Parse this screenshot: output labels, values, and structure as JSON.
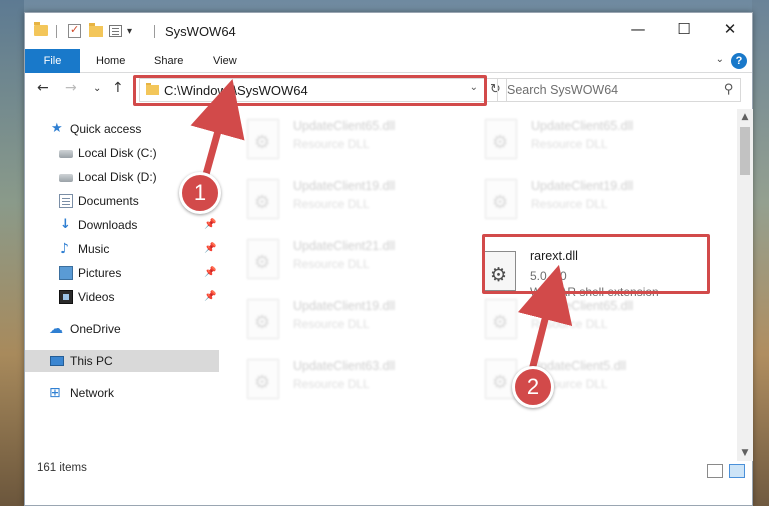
{
  "window": {
    "title": "SysWOW64",
    "controls": {
      "minimize": "—",
      "maximize": "☐",
      "close": "✕"
    },
    "quick_access_dropdown": "▾"
  },
  "ribbon": {
    "tabs": [
      {
        "label": "File"
      },
      {
        "label": "Home"
      },
      {
        "label": "Share"
      },
      {
        "label": "View"
      }
    ],
    "help": "?",
    "collapse": "⌄"
  },
  "nav": {
    "back": "←",
    "forward": "→",
    "recent": "⌄",
    "up": "↑",
    "address": "C:\\Windows\\SysWOW64",
    "address_chevron": "⌄",
    "refresh": "↻",
    "search_placeholder": "Search SysWOW64",
    "search_icon": "⚲"
  },
  "sidebar": {
    "items": [
      {
        "label": "Quick access",
        "icon": "star-icon",
        "glyph": "★"
      },
      {
        "label": "Local Disk (C:)",
        "icon": "disk-icon"
      },
      {
        "label": "Local Disk (D:)",
        "icon": "disk-icon"
      },
      {
        "label": "Documents",
        "icon": "documents-icon"
      },
      {
        "label": "Downloads",
        "icon": "downloads-icon",
        "glyph": "↓"
      },
      {
        "label": "Music",
        "icon": "music-icon",
        "glyph": "♪"
      },
      {
        "label": "Pictures",
        "icon": "pictures-icon"
      },
      {
        "label": "Videos",
        "icon": "videos-icon"
      },
      {
        "label": "OneDrive",
        "icon": "cloud-icon",
        "glyph": "☁"
      },
      {
        "label": "This PC",
        "icon": "pc-icon",
        "selected": true
      },
      {
        "label": "Network",
        "icon": "network-icon",
        "glyph": "⊞"
      }
    ],
    "pin": "📌"
  },
  "files": {
    "blurred": [
      {
        "name": "UpdateClient65.dll",
        "desc": "Resource DLL"
      },
      {
        "name": "UpdateClient65.dll",
        "desc": "Resource DLL"
      },
      {
        "name": "UpdateClient19.dll",
        "desc": "Resource DLL"
      },
      {
        "name": "UpdateClient19.dll",
        "desc": "Resource DLL"
      },
      {
        "name": "UpdateClient21.dll",
        "desc": "Resource DLL"
      },
      {
        "name": "UpdateClient19.dll",
        "desc": "Resource DLL"
      },
      {
        "name": "UpdateClient65.dll",
        "desc": "Resource DLL"
      },
      {
        "name": "UpdateClient63.dll",
        "desc": "Resource DLL"
      },
      {
        "name": "UpdateClient5.dll",
        "desc": "Resource DLL"
      }
    ],
    "highlighted": {
      "name": "rarext.dll",
      "version": "5.0.4.0",
      "desc": "WinRAR shell extension"
    }
  },
  "status": {
    "item_count": "161 items"
  },
  "annotations": {
    "step1": "1",
    "step2": "2",
    "color": "#d24a4a"
  }
}
